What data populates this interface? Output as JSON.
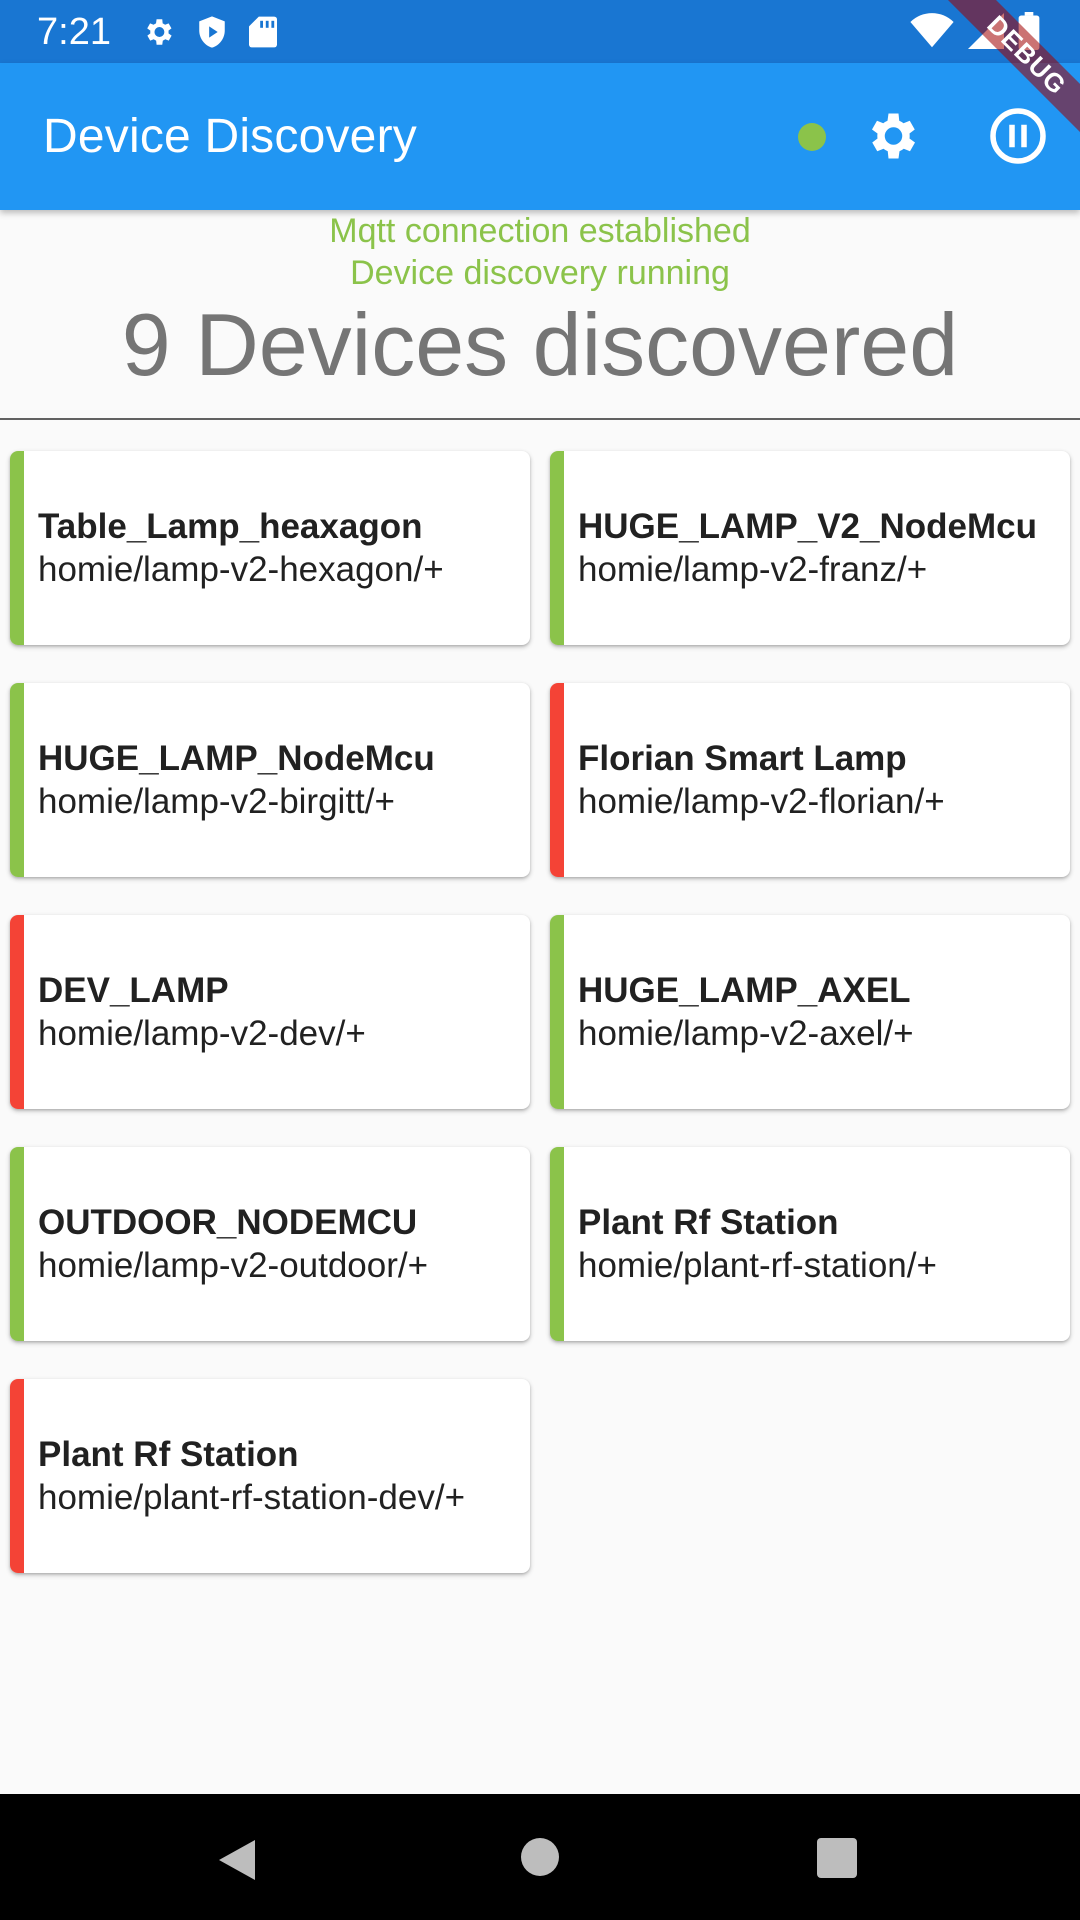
{
  "status_bar": {
    "time": "7:21",
    "left_icons": [
      "settings-icon",
      "shield-play-icon",
      "sd-card-icon"
    ],
    "right_icons": [
      "wifi-icon",
      "cell-signal-icon",
      "battery-icon"
    ]
  },
  "app_bar": {
    "title": "Device Discovery",
    "connection_dot_color": "#8bc34a",
    "actions": [
      "settings-icon",
      "pause-icon"
    ]
  },
  "debug_banner": "DEBUG",
  "header": {
    "connection_status": "Mqtt connection established",
    "discovery_status": "Device discovery running",
    "devices_count": "9 Devices discovered"
  },
  "colors": {
    "primary": "#2196f3",
    "status_bar": "#1976d2",
    "online": "#8bc34a",
    "offline": "#f44336"
  },
  "devices": [
    {
      "name": "Table_Lamp_heaxagon",
      "topic": "homie/lamp-v2-hexagon/+",
      "status": "online"
    },
    {
      "name": "HUGE_LAMP_V2_NodeMcu",
      "topic": "homie/lamp-v2-franz/+",
      "status": "online"
    },
    {
      "name": "HUGE_LAMP_NodeMcu",
      "topic": "homie/lamp-v2-birgitt/+",
      "status": "online"
    },
    {
      "name": "Florian Smart Lamp",
      "topic": "homie/lamp-v2-florian/+",
      "status": "offline"
    },
    {
      "name": "DEV_LAMP",
      "topic": "homie/lamp-v2-dev/+",
      "status": "offline"
    },
    {
      "name": "HUGE_LAMP_AXEL",
      "topic": "homie/lamp-v2-axel/+",
      "status": "online"
    },
    {
      "name": "OUTDOOR_NODEMCU",
      "topic": "homie/lamp-v2-outdoor/+",
      "status": "online"
    },
    {
      "name": "Plant Rf Station",
      "topic": "homie/plant-rf-station/+",
      "status": "online"
    },
    {
      "name": "Plant Rf Station",
      "topic": "homie/plant-rf-station-dev/+",
      "status": "offline"
    }
  ],
  "nav_bar": [
    "back-icon",
    "home-icon",
    "recents-icon"
  ]
}
